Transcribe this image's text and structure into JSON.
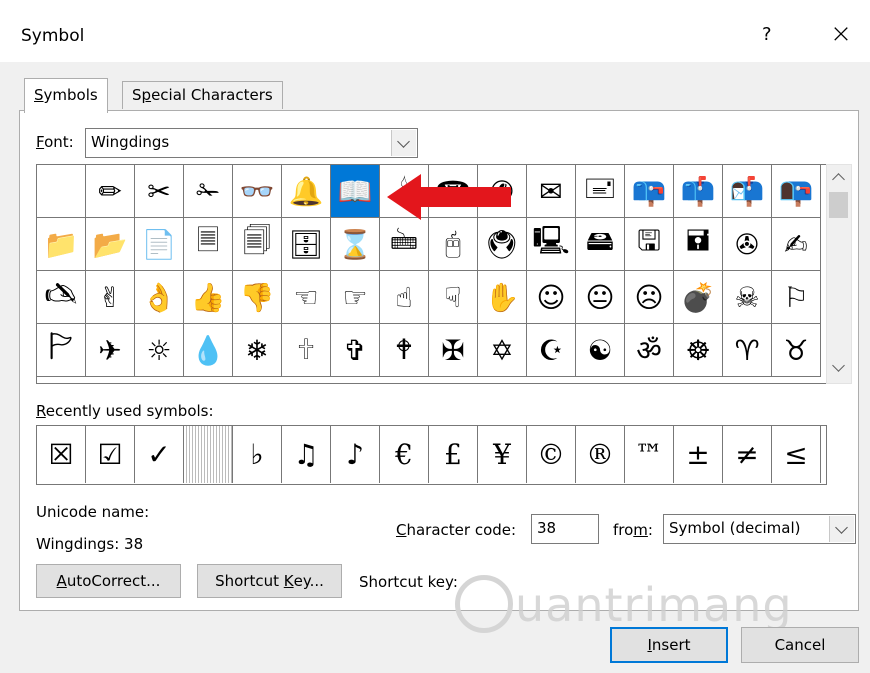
{
  "window": {
    "title": "Symbol",
    "help": "?",
    "close": "×"
  },
  "tabs": [
    {
      "label_key": "S",
      "label_rest": "ymbols"
    },
    {
      "label_pre": "S",
      "label_key": "p",
      "label_rest": "ecial Characters"
    }
  ],
  "font": {
    "label_key": "F",
    "label_rest": "ont:",
    "value": "Wingdings"
  },
  "symbol_grid": {
    "rows": [
      [
        "",
        "✏",
        "✂",
        "✁",
        "👓",
        "🔔",
        "📖",
        "🕯",
        "☎",
        "✆",
        "✉",
        "🖃",
        "📪",
        "📫",
        "📬",
        "📭"
      ],
      [
        "📁",
        "📂",
        "📄",
        "🗏",
        "🗐",
        "🗄",
        "⌛",
        "🖮",
        "🖰",
        "🖲",
        "🖳",
        "🖴",
        "🖫",
        "🖬",
        "✇",
        "✍"
      ],
      [
        "🖎",
        "✌",
        "👌",
        "👍",
        "👎",
        "☜",
        "☞",
        "☝",
        "☟",
        "✋",
        "☺",
        "😐",
        "☹",
        "💣",
        "☠",
        "⚐"
      ],
      [
        "🏱",
        "✈",
        "☼",
        "💧",
        "❄",
        "🕆",
        "✞",
        "🕈",
        "✠",
        "✡",
        "☪",
        "☯",
        "ॐ",
        "☸",
        "♈",
        "♉"
      ]
    ],
    "selected_index": 6
  },
  "recent": {
    "label_key": "R",
    "label_rest": "ecently used symbols:",
    "symbols": [
      "☒",
      "☑",
      "✓",
      "",
      "♭",
      "♫",
      "♪",
      "€",
      "£",
      "¥",
      "©",
      "®",
      "™",
      "±",
      "≠",
      "≤"
    ]
  },
  "unicode": {
    "name_label": "Unicode name:",
    "name_value": "Wingdings: 38"
  },
  "character_code": {
    "label_key": "C",
    "label_rest": "haracter code:",
    "value": "38"
  },
  "from": {
    "label_pre": "fro",
    "label_key": "m",
    "label_rest": ":",
    "value": "Symbol (decimal)"
  },
  "buttons": {
    "autocorrect_key": "A",
    "autocorrect_rest": "utoCorrect...",
    "shortcut_pre": "Shortcut ",
    "shortcut_key": "K",
    "shortcut_rest": "ey...",
    "insert_key": "I",
    "insert_rest": "nsert",
    "cancel": "Cancel"
  },
  "shortcut_key_label": "Shortcut key:",
  "watermark": "uantrimang",
  "colors": {
    "selection": "#0078d7",
    "arrow": "#e3161c",
    "default_button_border": "#0078d7"
  }
}
